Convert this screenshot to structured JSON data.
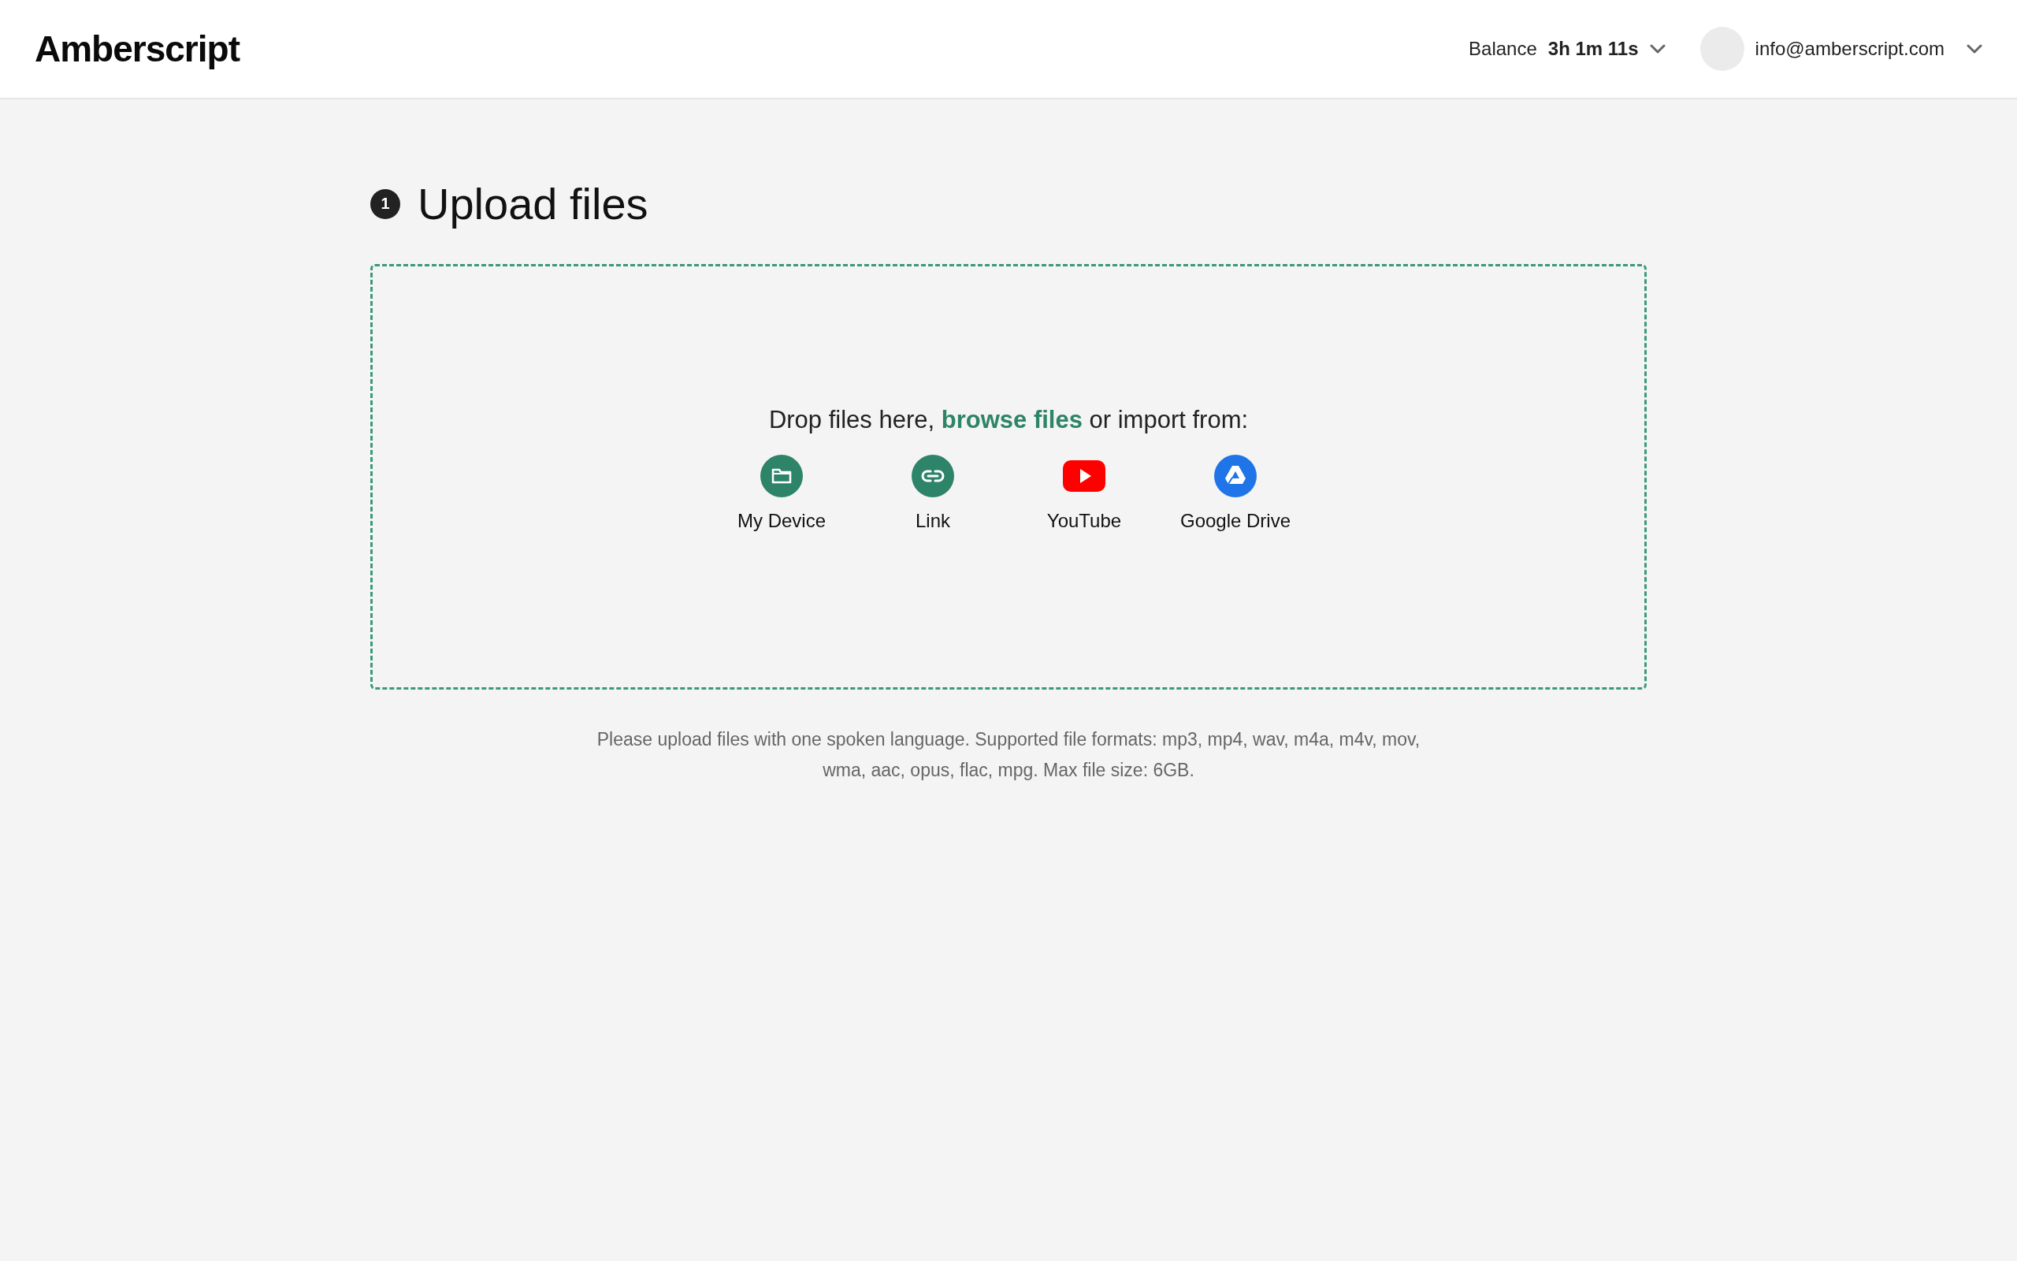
{
  "header": {
    "logo": "Amberscript",
    "balance_label": "Balance",
    "balance_value": "3h 1m 11s",
    "account_email": "info@amberscript.com"
  },
  "step": {
    "number": "1",
    "title": "Upload files"
  },
  "dropzone": {
    "prompt_start": "Drop files here,",
    "browse_link": "browse files",
    "prompt_end": "or import from:",
    "sources": [
      {
        "kind": "device",
        "label": "My Device"
      },
      {
        "kind": "link",
        "label": "Link"
      },
      {
        "kind": "youtube",
        "label": "YouTube"
      },
      {
        "kind": "drive",
        "label": "Google Drive"
      }
    ]
  },
  "note": "Please upload files with one spoken language. Supported file formats: mp3, mp4, wav, m4a, m4v, mov, wma, aac, opus, flac, mpg. Max file size: 6GB."
}
